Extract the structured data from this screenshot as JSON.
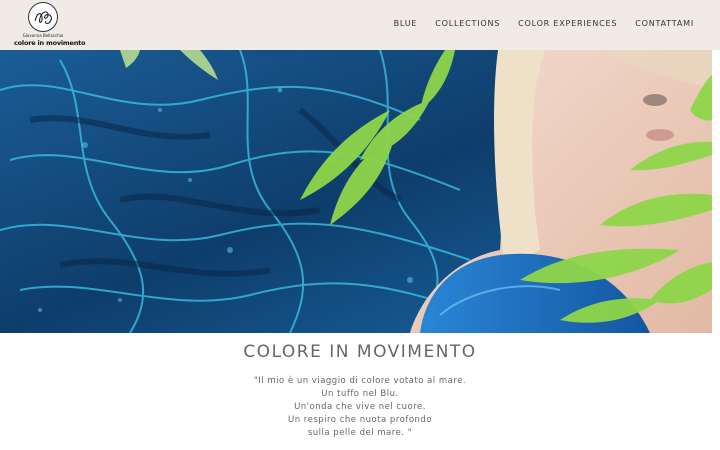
{
  "brand": {
    "name": "Giovanna Bellacchio",
    "tagline": "colore in movimento"
  },
  "nav": {
    "items": [
      {
        "label": "BLUE"
      },
      {
        "label": "COLLECTIONS"
      },
      {
        "label": "COLOR EXPERIENCES"
      },
      {
        "label": "CONTATTAMI"
      }
    ]
  },
  "colors": {
    "header_bg": "#f1ebe6",
    "text": "#666666",
    "fabric_blue": "#1f6fb0",
    "accent_cyan": "#38c3e6",
    "leaf_green": "#8fd64a"
  },
  "main": {
    "title": "COLORE IN MOVIMENTO",
    "quote_lines": [
      "\"Il mio è un viaggio di colore votato al mare.",
      "Un tuffo nel Blu.",
      "Un'onda che vive nel cuore.",
      "Un respiro che nuota profondo",
      "sulla pelle del mare. \""
    ]
  }
}
